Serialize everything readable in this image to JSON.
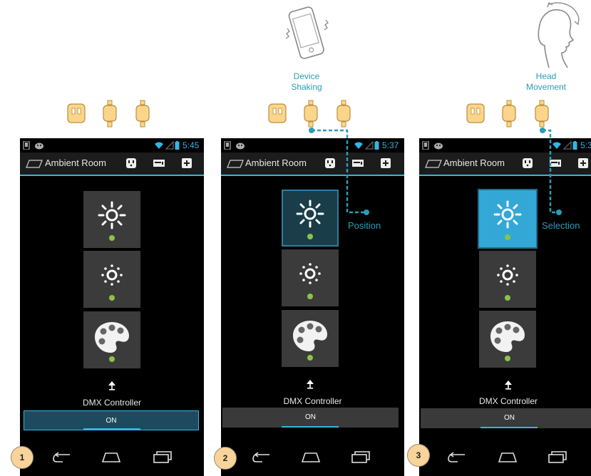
{
  "app": {
    "title": "Ambient Room"
  },
  "screens": [
    {
      "time": "5:45",
      "badge": "1"
    },
    {
      "time": "5:37",
      "badge": "2",
      "callout": "Position"
    },
    {
      "time": "5:3",
      "badge": "3",
      "callout": "Selection"
    }
  ],
  "device": {
    "name": "DMX Controller",
    "on_label": "ON"
  },
  "annotations": {
    "shake": "Device\nShaking",
    "head": "Head\nMovement"
  },
  "colors": {
    "accent": "#33b5e5",
    "status_dot": "#8bc34a",
    "annotation": "#2b9cb7",
    "badge": "#f8d49a"
  }
}
